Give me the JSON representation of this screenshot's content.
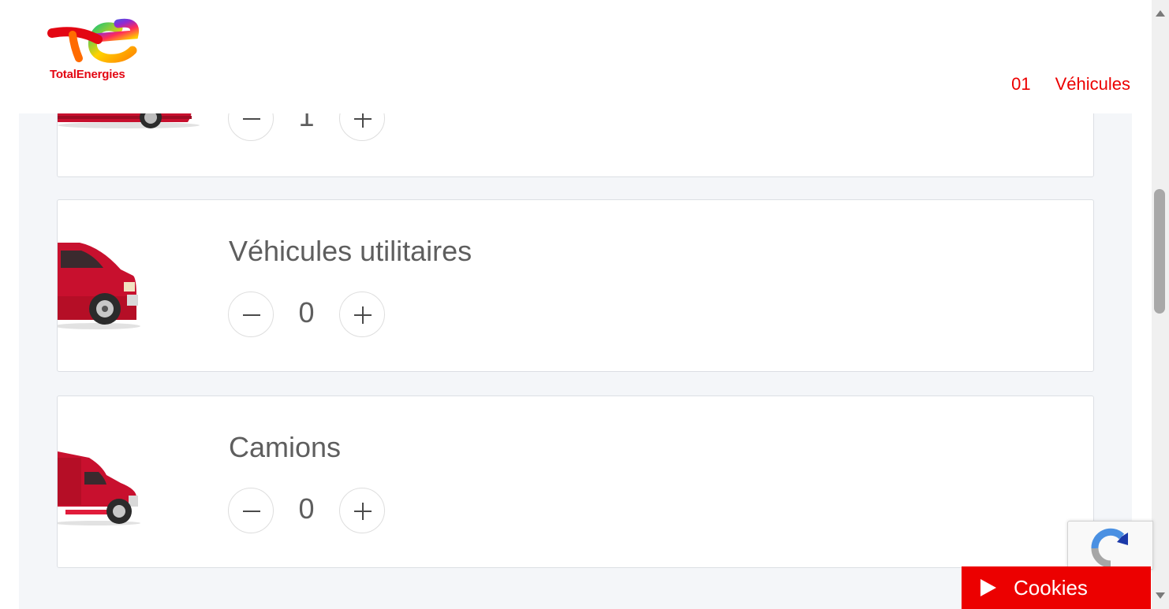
{
  "header": {
    "logo_text": "TotalEnergies",
    "nav": {
      "step": "01",
      "label": "Véhicules"
    }
  },
  "cards": [
    {
      "title": "",
      "quantity": "1",
      "icon": "car-icon"
    },
    {
      "title": "Véhicules utilitaires",
      "quantity": "0",
      "icon": "van-icon"
    },
    {
      "title": "Camions",
      "quantity": "0",
      "icon": "truck-icon"
    }
  ],
  "cookies": {
    "label": "Cookies"
  },
  "colors": {
    "brand_red": "#ec0000",
    "page_bg": "#f4f6f9",
    "text_gray": "#5e5e5e"
  }
}
